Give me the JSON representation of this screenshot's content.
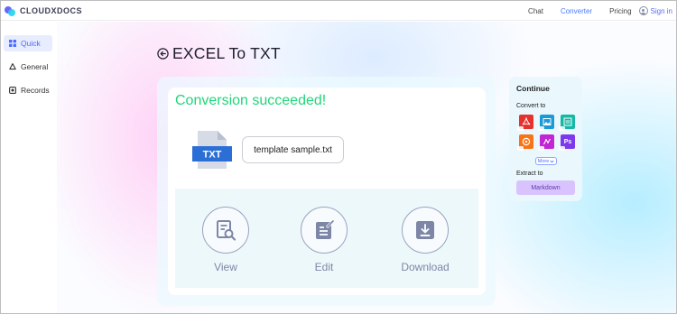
{
  "header": {
    "brand": "CLOUDXDOCS",
    "nav": [
      {
        "label": "Chat",
        "active": false
      },
      {
        "label": "Converter",
        "active": true
      },
      {
        "label": "Pricing",
        "active": false
      }
    ],
    "signin_label": "Sign in"
  },
  "sidebar": {
    "items": [
      {
        "label": "Quick",
        "icon": "grid-icon",
        "active": true
      },
      {
        "label": "General",
        "icon": "recycle-icon",
        "active": false
      },
      {
        "label": "Records",
        "icon": "record-icon",
        "active": false
      }
    ]
  },
  "main": {
    "title": "EXCEL To TXT",
    "status": "Conversion succeeded!",
    "file_type_label": "TXT",
    "filename": "template sample.txt",
    "actions": [
      {
        "label": "View",
        "icon": "view-document-icon"
      },
      {
        "label": "Edit",
        "icon": "edit-document-icon"
      },
      {
        "label": "Download",
        "icon": "download-icon"
      }
    ]
  },
  "continue_panel": {
    "title": "Continue",
    "convert_to_label": "Convert to",
    "formats": [
      {
        "icon": "pdf-icon",
        "color": "#e5322d"
      },
      {
        "icon": "image-icon",
        "color": "#1a9bd7"
      },
      {
        "icon": "html-icon",
        "color": "#14b8a6"
      },
      {
        "icon": "office-icon",
        "color": "#f97316"
      },
      {
        "icon": "vector-icon",
        "color": "#c026d3"
      },
      {
        "icon": "photoshop-icon",
        "color": "#7c3aed",
        "text": "Ps"
      }
    ],
    "more_label": "More",
    "extract_to_label": "Extract to",
    "extract_option": "Markdown"
  },
  "colors": {
    "accent": "#4c6cff",
    "success": "#1fd67a",
    "file_blue": "#2b6fd6"
  }
}
